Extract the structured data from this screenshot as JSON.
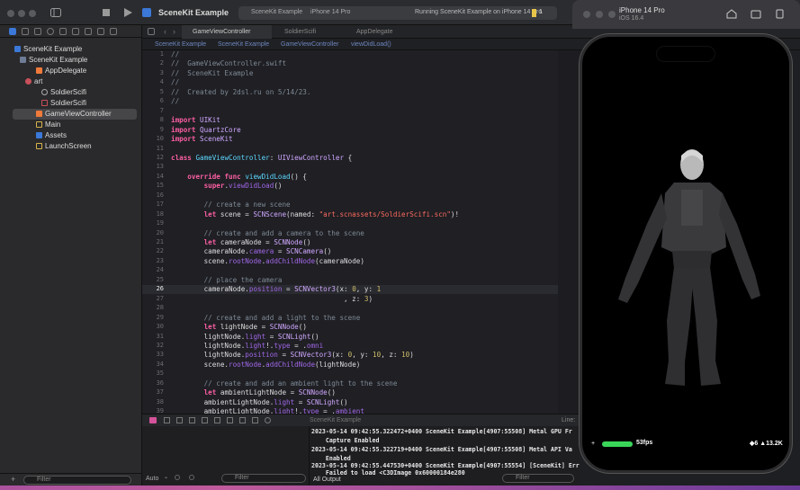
{
  "window": {
    "scheme": "SceneKit Example",
    "breadcrumb_scheme": "SceneKit Example",
    "breadcrumb_device": "iPhone 14 Pro",
    "status": "Running SceneKit Example on iPhone 14 Pro",
    "warning_count": "1"
  },
  "navigator": {
    "items": [
      {
        "label": "SceneKit Example"
      },
      {
        "label": "SceneKit Example"
      },
      {
        "label": "AppDelegate"
      },
      {
        "label": "art"
      },
      {
        "label": "SoldierScifi"
      },
      {
        "label": "SoldierScifi"
      },
      {
        "label": "GameViewController"
      },
      {
        "label": "Main"
      },
      {
        "label": "Assets"
      },
      {
        "label": "LaunchScreen"
      }
    ],
    "filter_placeholder": "Filter"
  },
  "tabs": [
    {
      "label": "GameViewController"
    },
    {
      "label": "SoldierScifi"
    },
    {
      "label": "AppDelegate"
    }
  ],
  "jumpbar": [
    "SceneKit Example",
    "SceneKit Example",
    "GameViewController",
    "viewDidLoad()"
  ],
  "debug": {
    "scheme_label": "SceneKit Example",
    "line_label": "Line:",
    "auto_label": "Auto",
    "filter_placeholder": "Filter",
    "all_output": "All Output",
    "console_lines": [
      "2023-05-14 09:42:55.322472+0400 SceneKit Example[4907:55508] Metal GPU Fr",
      "    Capture Enabled",
      "2023-05-14 09:42:55.322719+0400 SceneKit Example[4907:55508] Metal API Va",
      "    Enabled",
      "2023-05-14 09:42:55.447530+0400 SceneKit Example[4907:55554] [SceneKit] Err",
      "    Failed to load <C3DImage 0x60000184e280"
    ]
  },
  "simulator": {
    "device": "iPhone 14 Pro",
    "os": "iOS 16.4",
    "fps": "53fps",
    "stats": "◆6 ▲13.2K"
  },
  "code": {
    "line_numbers": [
      "1",
      "2",
      "3",
      "4",
      "5",
      "6",
      "7",
      "8",
      "9",
      "10",
      "11",
      "12",
      "13",
      "14",
      "15",
      "16",
      "17",
      "18",
      "19",
      "20",
      "21",
      "22",
      "23",
      "24",
      "25",
      "26",
      "27",
      "28",
      "29",
      "30",
      "31",
      "32",
      "33",
      "34",
      "35",
      "36",
      "37",
      "38",
      "39"
    ],
    "lines": [
      "//",
      "//  GameViewController.swift",
      "//  SceneKit Example",
      "//",
      "//  Created by 2dsl.ru on 5/14/23.",
      "//",
      "",
      "import UIKit",
      "import QuartzCore",
      "import SceneKit",
      "",
      "class GameViewController: UIViewController {",
      "",
      "    override func viewDidLoad() {",
      "        super.viewDidLoad()",
      "",
      "        // create a new scene",
      "        let scene = SCNScene(named: \"art.scnassets/SoldierScifi.scn\")!",
      "",
      "        // create and add a camera to the scene",
      "        let cameraNode = SCNNode()",
      "        cameraNode.camera = SCNCamera()",
      "        scene.rootNode.addChildNode(cameraNode)",
      "",
      "        // place the camera",
      "        cameraNode.position = SCNVector3(x: 0, y: 1",
      "                                          , z: 3)",
      "",
      "        // create and add a light to the scene",
      "        let lightNode = SCNNode()",
      "        lightNode.light = SCNLight()",
      "        lightNode.light!.type = .omni",
      "        lightNode.position = SCNVector3(x: 0, y: 10, z: 10)",
      "        scene.rootNode.addChildNode(lightNode)",
      "",
      "        // create and add an ambient light to the scene",
      "        let ambientLightNode = SCNNode()",
      "        ambientLightNode.light = SCNLight()",
      "        ambientLightNode.light!.type = .ambient"
    ]
  },
  "colors": {
    "accent": "#3478f6",
    "fps_bar": "#3ad65a"
  }
}
